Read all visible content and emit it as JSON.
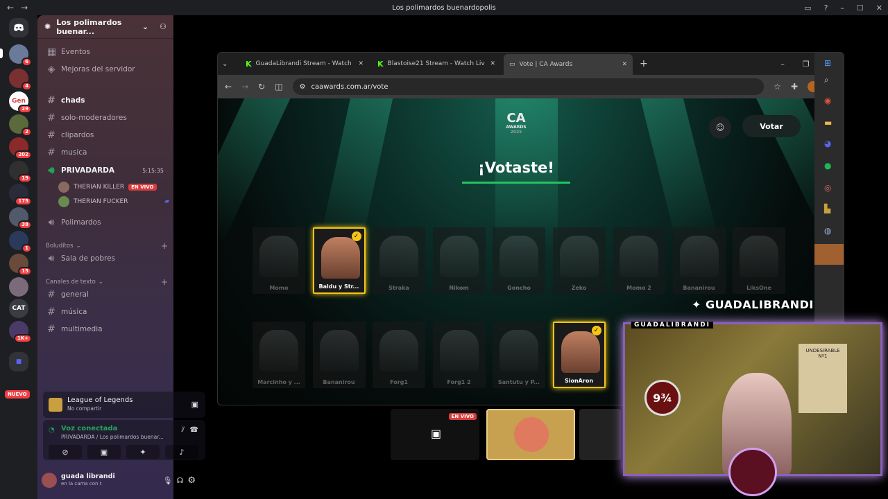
{
  "window": {
    "title": "Los polimardos buenardopolis"
  },
  "guilds": [
    {
      "label": "",
      "badge": "6"
    },
    {
      "label": "",
      "badge": "4"
    },
    {
      "label": "Gen",
      "badge": "29"
    },
    {
      "label": "",
      "badge": "2"
    },
    {
      "label": "",
      "badge": "202"
    },
    {
      "label": "",
      "badge": "19"
    },
    {
      "label": "",
      "badge": "175"
    },
    {
      "label": "",
      "badge": "38"
    },
    {
      "label": "",
      "badge": "1"
    },
    {
      "label": "",
      "badge": "15"
    },
    {
      "label": "",
      "badge": ""
    },
    {
      "label": "CAT",
      "badge": ""
    },
    {
      "label": "",
      "badge": "1K+"
    }
  ],
  "guild_new": "NUEVO",
  "server": {
    "name": "Los polimardos buenar..."
  },
  "sidebar": {
    "events": "Eventos",
    "boosts": "Mejoras del servidor",
    "channels": [
      "chads",
      "solo-moderadores",
      "clipardos",
      "musica"
    ],
    "voice_active": {
      "name": "PRIVADARDA",
      "time": "5:15:35"
    },
    "voice_users": [
      {
        "name": "THERIAN KILLER",
        "badge": "EN VIVO"
      },
      {
        "name": "THERIAN FUCKER",
        "badge": ""
      }
    ],
    "voice_other": "Polimardos",
    "cat1": "Boludítos",
    "cat1_channel": "Sala de pobres",
    "cat2": "Canales de texto",
    "cat2_channels": [
      "general",
      "música",
      "multimedia"
    ]
  },
  "activity": {
    "game": "League of Legends",
    "sub": "No compartir"
  },
  "voice": {
    "status": "Voz conectada",
    "where": "PRIVADARDA / Los polimardos buenar..."
  },
  "user": {
    "name": "guada librandi",
    "status": "en la cama con t"
  },
  "browser": {
    "tabs": [
      "GuadaLibrandi Stream - Watch",
      "Blastoise21 Stream - Watch Liv",
      "Vote | CA Awards"
    ],
    "url": "caawards.com.ar/vote"
  },
  "site": {
    "logo": "CA",
    "logo_sub": "AWARDS",
    "logo_year": "2025",
    "heading": "¡Votaste!",
    "votar": "Votar",
    "row1": [
      {
        "name": "Momo",
        "selected": false
      },
      {
        "name": "Baldu y Str...",
        "selected": true
      },
      {
        "name": "Straka",
        "selected": false
      },
      {
        "name": "Nikom",
        "selected": false
      },
      {
        "name": "Goncho",
        "selected": false
      },
      {
        "name": "Zeko",
        "selected": false
      },
      {
        "name": "Momo 2",
        "selected": false
      },
      {
        "name": "Bananirou",
        "selected": false
      },
      {
        "name": "LiksOne",
        "selected": false
      }
    ],
    "row2": [
      {
        "name": "Marcinho y ...",
        "selected": false
      },
      {
        "name": "Bananirou",
        "selected": false
      },
      {
        "name": "Forg1",
        "selected": false
      },
      {
        "name": "Forg1 2",
        "selected": false
      },
      {
        "name": "Santutu y P...",
        "selected": false
      },
      {
        "name": "SionAron",
        "selected": true
      }
    ]
  },
  "overlay": {
    "twitter": "GUADALIBRANDI",
    "cam_label": "GUADALIBRANDI",
    "live": "EN VIVO"
  }
}
